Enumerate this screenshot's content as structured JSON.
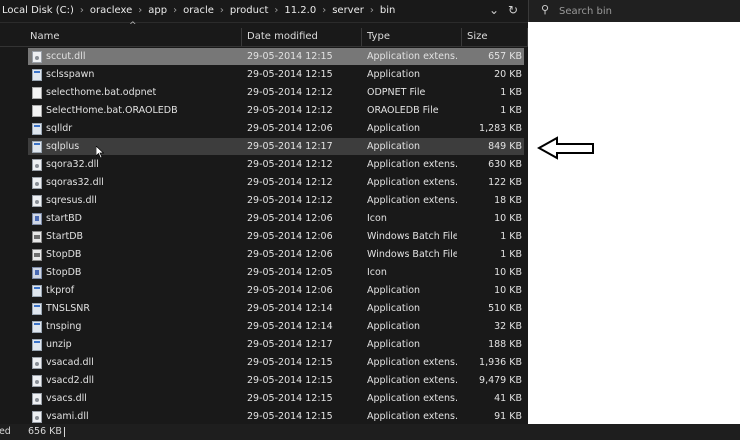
{
  "breadcrumb": [
    "Local Disk (C:)",
    "oraclexe",
    "app",
    "oracle",
    "product",
    "11.2.0",
    "server",
    "bin"
  ],
  "search": {
    "placeholder": "Search bin"
  },
  "columns": {
    "name": "Name",
    "date": "Date modified",
    "type": "Type",
    "size": "Size"
  },
  "files": [
    {
      "name": "sccut.dll",
      "date": "29-05-2014 12:15",
      "type": "Application extens...",
      "size": "657 KB",
      "icon": "dll",
      "state": "selected"
    },
    {
      "name": "sclsspawn",
      "date": "29-05-2014 12:15",
      "type": "Application",
      "size": "20 KB",
      "icon": "exe"
    },
    {
      "name": "selecthome.bat.odpnet",
      "date": "29-05-2014 12:12",
      "type": "ODPNET File",
      "size": "1 KB",
      "icon": "file"
    },
    {
      "name": "SelectHome.bat.ORAOLEDB",
      "date": "29-05-2014 12:12",
      "type": "ORAOLEDB File",
      "size": "1 KB",
      "icon": "file"
    },
    {
      "name": "sqlldr",
      "date": "29-05-2014 12:06",
      "type": "Application",
      "size": "1,283 KB",
      "icon": "exe"
    },
    {
      "name": "sqlplus",
      "date": "29-05-2014 12:17",
      "type": "Application",
      "size": "849 KB",
      "icon": "exe",
      "state": "hover"
    },
    {
      "name": "sqora32.dll",
      "date": "29-05-2014 12:12",
      "type": "Application extens...",
      "size": "630 KB",
      "icon": "dll"
    },
    {
      "name": "sqoras32.dll",
      "date": "29-05-2014 12:12",
      "type": "Application extens...",
      "size": "122 KB",
      "icon": "dll"
    },
    {
      "name": "sqresus.dll",
      "date": "29-05-2014 12:12",
      "type": "Application extens...",
      "size": "18 KB",
      "icon": "dll"
    },
    {
      "name": "startBD",
      "date": "29-05-2014 12:06",
      "type": "Icon",
      "size": "10 KB",
      "icon": "ico"
    },
    {
      "name": "StartDB",
      "date": "29-05-2014 12:06",
      "type": "Windows Batch File",
      "size": "1 KB",
      "icon": "bat"
    },
    {
      "name": "StopDB",
      "date": "29-05-2014 12:06",
      "type": "Windows Batch File",
      "size": "1 KB",
      "icon": "bat"
    },
    {
      "name": "StopDB",
      "date": "29-05-2014 12:05",
      "type": "Icon",
      "size": "10 KB",
      "icon": "ico"
    },
    {
      "name": "tkprof",
      "date": "29-05-2014 12:06",
      "type": "Application",
      "size": "10 KB",
      "icon": "exe"
    },
    {
      "name": "TNSLSNR",
      "date": "29-05-2014 12:14",
      "type": "Application",
      "size": "510 KB",
      "icon": "exe"
    },
    {
      "name": "tnsping",
      "date": "29-05-2014 12:14",
      "type": "Application",
      "size": "32 KB",
      "icon": "exe"
    },
    {
      "name": "unzip",
      "date": "29-05-2014 12:17",
      "type": "Application",
      "size": "188 KB",
      "icon": "exe"
    },
    {
      "name": "vsacad.dll",
      "date": "29-05-2014 12:15",
      "type": "Application extens...",
      "size": "1,936 KB",
      "icon": "dll"
    },
    {
      "name": "vsacd2.dll",
      "date": "29-05-2014 12:15",
      "type": "Application extens...",
      "size": "9,479 KB",
      "icon": "dll"
    },
    {
      "name": "vsacs.dll",
      "date": "29-05-2014 12:15",
      "type": "Application extens...",
      "size": "41 KB",
      "icon": "dll"
    },
    {
      "name": "vsami.dll",
      "date": "29-05-2014 12:15",
      "type": "Application extens...",
      "size": "91 KB",
      "icon": "dll"
    }
  ],
  "status": {
    "selection": "cted",
    "size": "656 KB"
  },
  "colors": {
    "background": "#191919",
    "selected_row": "#777777",
    "hover_row": "#3d3d3d",
    "text": "#e2e2e2"
  }
}
